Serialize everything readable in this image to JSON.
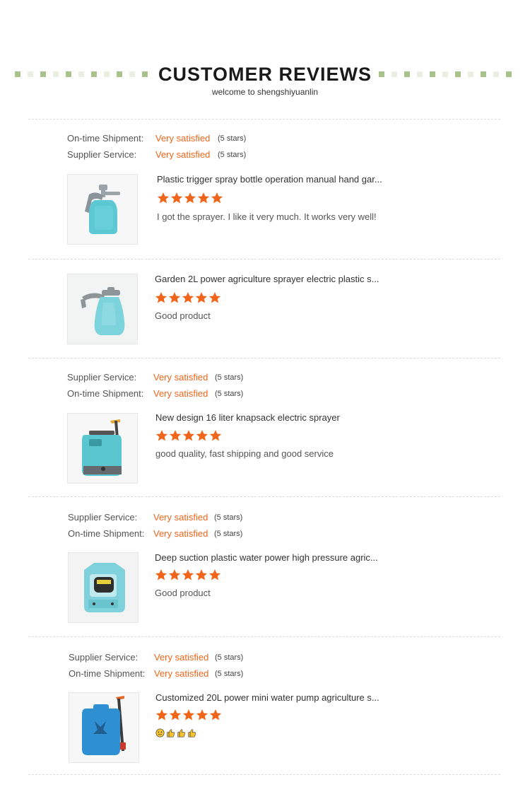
{
  "header": {
    "title": "CUSTOMER REVIEWS",
    "subtitle": "welcome to shengshiyuanlin",
    "deco_colors": [
      "#a9c18a",
      "#e8eee0"
    ]
  },
  "colors": {
    "accent": "#f0651a",
    "star": "#f0651a",
    "divider": "#dcdcdc"
  },
  "reviews": [
    {
      "ratings": [
        {
          "label": "On-time Shipment:",
          "value": "Very satisfied",
          "stars": "(5 stars)"
        },
        {
          "label": "Supplier Service:",
          "value": "Very satisfied",
          "stars": "(5 stars)"
        }
      ],
      "product_title": "Plastic trigger spray bottle operation manual hand gar...",
      "product_image": "trigger-spray-bottle-image",
      "rating": 5,
      "comment": "I got the sprayer. I like it very much. It works very well!"
    },
    {
      "ratings": [],
      "product_title": "Garden 2L power agriculture sprayer electric plastic s...",
      "product_image": "garden-sprayer-bottle-image",
      "rating": 5,
      "comment": "Good product"
    },
    {
      "ratings": [
        {
          "label": "Supplier Service:",
          "value": "Very satisfied",
          "stars": "(5 stars)"
        },
        {
          "label": "On-time Shipment:",
          "value": "Very satisfied",
          "stars": "(5 stars)"
        }
      ],
      "product_title": "New design 16 liter knapsack electric sprayer",
      "product_image": "knapsack-sprayer-image",
      "rating": 5,
      "comment": "good quality, fast shipping and good service"
    },
    {
      "ratings": [
        {
          "label": "Supplier Service:",
          "value": "Very satisfied",
          "stars": "(5 stars)"
        },
        {
          "label": "On-time Shipment:",
          "value": "Very satisfied",
          "stars": "(5 stars)"
        }
      ],
      "product_title": "Deep suction plastic water power high pressure agric...",
      "product_image": "water-pump-image",
      "rating": 5,
      "comment": "Good product"
    },
    {
      "ratings": [
        {
          "label": "Supplier Service:",
          "value": "Very satisfied",
          "stars": "(5 stars)"
        },
        {
          "label": "On-time Shipment:",
          "value": "Very satisfied",
          "stars": "(5 stars)"
        }
      ],
      "product_title": "Customized 20L power mini water pump agriculture s...",
      "product_image": "blue-backpack-sprayer-image",
      "rating": 5,
      "comment": "",
      "comment_icons": [
        "smile-emoji-icon",
        "thumbs-up-emoji-icon",
        "thumbs-up-emoji-icon",
        "thumbs-up-emoji-icon"
      ]
    }
  ]
}
